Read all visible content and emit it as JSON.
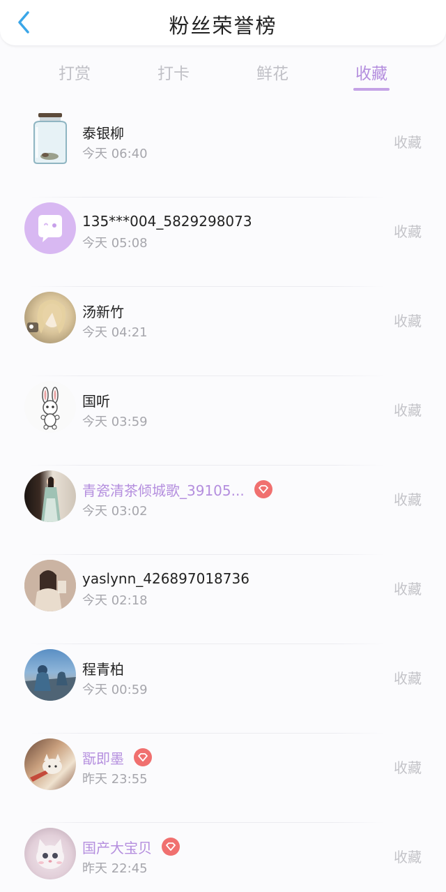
{
  "header": {
    "title": "粉丝荣誉榜",
    "back_icon": "chevron-left-icon"
  },
  "colors": {
    "accent": "#b48ede",
    "back_arrow": "#3aa6e8",
    "badge": "#f0706f",
    "muted": "#a6a6ac"
  },
  "tabs": [
    {
      "label": "打赏",
      "active": false
    },
    {
      "label": "打卡",
      "active": false
    },
    {
      "label": "鲜花",
      "active": false
    },
    {
      "label": "收藏",
      "active": true
    }
  ],
  "fans": [
    {
      "name": "泰银柳",
      "time": "今天 06:40",
      "action": "收藏",
      "vip": false,
      "avatar": "glass-jar-icon"
    },
    {
      "name": "135***004_5829298073",
      "time": "今天 05:08",
      "action": "收藏",
      "vip": false,
      "avatar": "default-chat-avatar-icon"
    },
    {
      "name": "汤新竹",
      "time": "今天 04:21",
      "action": "收藏",
      "vip": false,
      "avatar": "anime-portrait-avatar"
    },
    {
      "name": "国听",
      "time": "今天 03:59",
      "action": "收藏",
      "vip": false,
      "avatar": "bunny-avatar"
    },
    {
      "name": "青瓷清茶倾城歌_39105...",
      "time": "今天 03:02",
      "action": "收藏",
      "vip": true,
      "avatar": "photo-girl-avatar"
    },
    {
      "name": "yaslynn_426897018736",
      "time": "今天 02:18",
      "action": "收藏",
      "vip": false,
      "avatar": "illustrated-girl-avatar"
    },
    {
      "name": "程青柏",
      "time": "今天 00:59",
      "action": "收藏",
      "vip": false,
      "avatar": "seaside-avatar"
    },
    {
      "name": "翫即墨",
      "time": "昨天 23:55",
      "action": "收藏",
      "vip": true,
      "avatar": "anime-cat-avatar"
    },
    {
      "name": "国产大宝贝",
      "time": "昨天 22:45",
      "action": "收藏",
      "vip": true,
      "avatar": "kitten-avatar"
    }
  ],
  "vip_badge_icon": "diamond-badge-icon"
}
